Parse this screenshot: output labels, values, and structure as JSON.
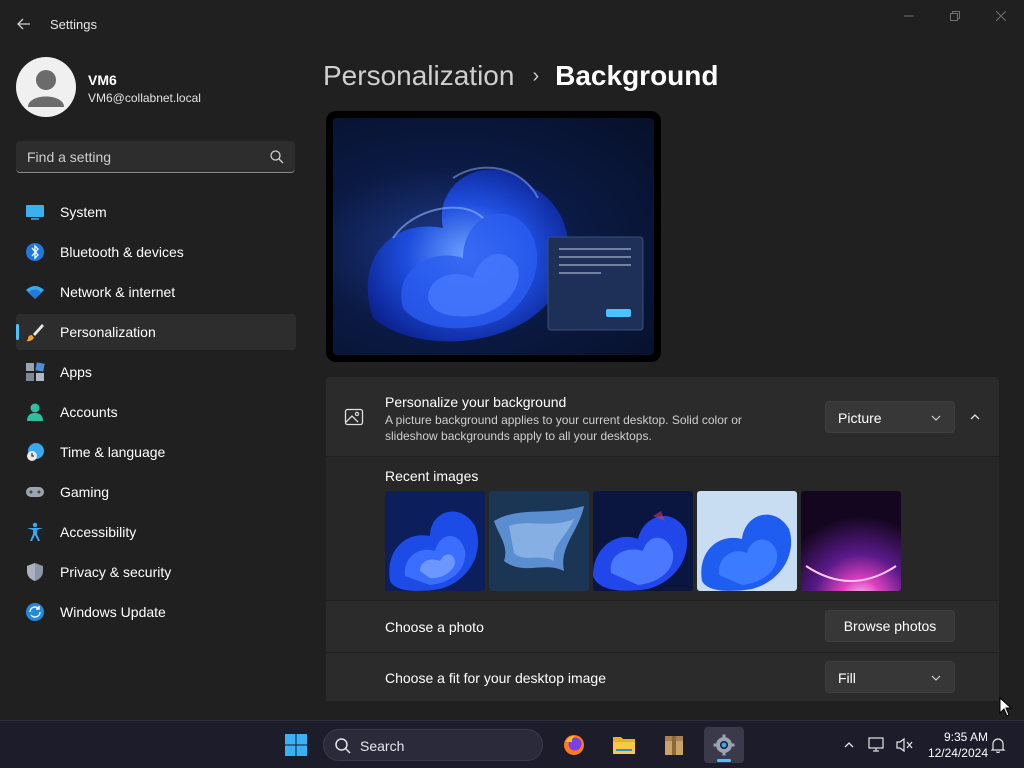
{
  "window": {
    "title": "Settings",
    "back_icon": "back-arrow-icon",
    "controls": [
      "minimize-icon",
      "maximize-icon",
      "close-icon"
    ]
  },
  "profile": {
    "name": "VM6",
    "email": "VM6@collabnet.local"
  },
  "search": {
    "placeholder": "Find a setting",
    "icon": "search-icon"
  },
  "sidebar": {
    "items": [
      {
        "label": "System",
        "icon": "system-icon",
        "active": false
      },
      {
        "label": "Bluetooth & devices",
        "icon": "bluetooth-icon",
        "active": false
      },
      {
        "label": "Network & internet",
        "icon": "wifi-icon",
        "active": false
      },
      {
        "label": "Personalization",
        "icon": "brush-icon",
        "active": true
      },
      {
        "label": "Apps",
        "icon": "apps-icon",
        "active": false
      },
      {
        "label": "Accounts",
        "icon": "accounts-icon",
        "active": false
      },
      {
        "label": "Time & language",
        "icon": "clock-globe-icon",
        "active": false
      },
      {
        "label": "Gaming",
        "icon": "gamepad-icon",
        "active": false
      },
      {
        "label": "Accessibility",
        "icon": "accessibility-icon",
        "active": false
      },
      {
        "label": "Privacy & security",
        "icon": "shield-icon",
        "active": false
      },
      {
        "label": "Windows Update",
        "icon": "update-icon",
        "active": false
      }
    ]
  },
  "breadcrumb": {
    "parent": "Personalization",
    "separator": "›",
    "current": "Background"
  },
  "personalize": {
    "title": "Personalize your background",
    "description": "A picture background applies to your current desktop. Solid color or slideshow backgrounds apply to all your desktops.",
    "selected": "Picture",
    "icon": "image-icon"
  },
  "recent": {
    "label": "Recent images",
    "images": [
      "bloom-dark-blue",
      "flow-blue",
      "bloom-blue-alt",
      "bloom-light",
      "glow-purple"
    ]
  },
  "choose_photo": {
    "label": "Choose a photo",
    "button": "Browse photos"
  },
  "fit": {
    "label": "Choose a fit for your desktop image",
    "selected": "Fill"
  },
  "taskbar": {
    "search_label": "Search",
    "apps": [
      "firefox-icon",
      "file-explorer-icon",
      "archive-icon",
      "settings-icon"
    ],
    "active_app": "settings-icon",
    "time": "9:35 AM",
    "date": "12/24/2024"
  },
  "colors": {
    "accent": "#4cc2ff",
    "background": "#202020",
    "card": "#2b2b2b"
  }
}
